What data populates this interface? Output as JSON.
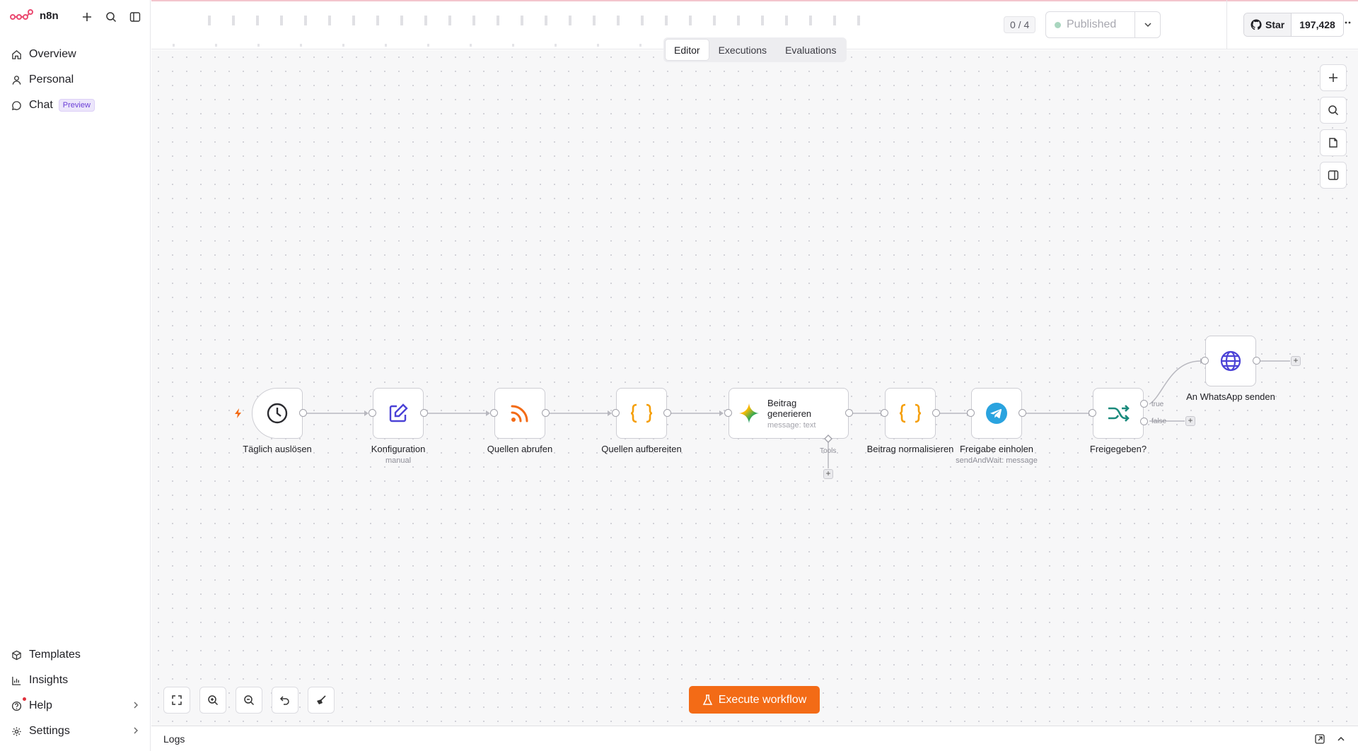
{
  "brand": {
    "name": "n8n",
    "accent": "#ea4b71"
  },
  "sidebar": {
    "top_items": [
      {
        "label": "Overview",
        "icon": "home-icon"
      },
      {
        "label": "Personal",
        "icon": "user-icon"
      },
      {
        "label": "Chat",
        "icon": "chat-icon",
        "badge": "Preview"
      }
    ],
    "bottom_items": [
      {
        "label": "Templates",
        "icon": "box-icon"
      },
      {
        "label": "Insights",
        "icon": "chart-icon"
      },
      {
        "label": "Help",
        "icon": "help-icon"
      },
      {
        "label": "Settings",
        "icon": "gear-icon"
      }
    ]
  },
  "header": {
    "counter": "0 / 4",
    "status": "Published",
    "status_color": "#a9d6bf",
    "tabs": [
      {
        "label": "Editor",
        "active": true
      },
      {
        "label": "Executions",
        "active": false
      },
      {
        "label": "Evaluations",
        "active": false
      }
    ],
    "github": {
      "star_label": "Star",
      "star_count": "197,428"
    }
  },
  "workflow": {
    "nodes": [
      {
        "label": "Täglich auslösen",
        "sub": "",
        "icon": "clock-icon"
      },
      {
        "label": "Konfiguration",
        "sub": "manual",
        "icon": "edit-icon"
      },
      {
        "label": "Quellen abrufen",
        "sub": "",
        "icon": "rss-icon"
      },
      {
        "label": "Quellen aufbereiten",
        "sub": "",
        "icon": "code-braces-icon"
      },
      {
        "label": "Beitrag generieren",
        "sub": "message: text",
        "icon": "gemini-icon"
      },
      {
        "label": "Beitrag normalisieren",
        "sub": "",
        "icon": "code-braces-icon"
      },
      {
        "label": "Freigabe einholen",
        "sub": "sendAndWait: message",
        "icon": "telegram-icon"
      },
      {
        "label": "Freigegeben?",
        "sub": "",
        "icon": "if-branch-icon"
      },
      {
        "label": "An WhatsApp senden",
        "sub": "",
        "icon": "globe-icon"
      }
    ],
    "tools_label": "Tools",
    "true_label": "true",
    "false_label": "false"
  },
  "execute": {
    "label": "Execute workflow",
    "color": "#f36b16"
  },
  "logs": {
    "label": "Logs"
  }
}
